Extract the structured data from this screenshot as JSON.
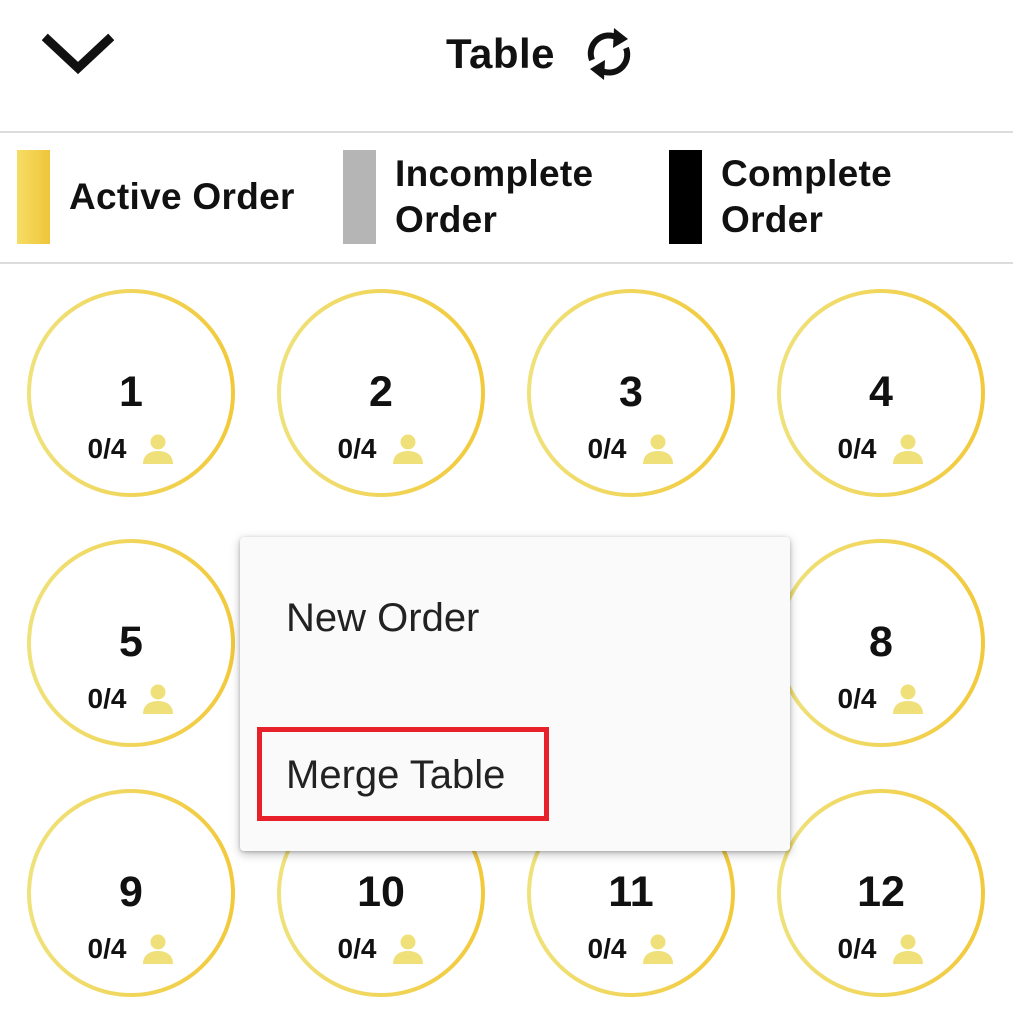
{
  "header": {
    "title": "Table",
    "back_icon": "chevron-down-icon",
    "refresh_icon": "refresh-icon"
  },
  "legend": [
    {
      "label": "Active Order",
      "color": "#f2cf4a"
    },
    {
      "label": "Incomplete\nOrder",
      "color": "#b5b5b5"
    },
    {
      "label": "Complete\nOrder",
      "color": "#000000"
    }
  ],
  "tables": [
    {
      "number": "1",
      "seats": "0/4"
    },
    {
      "number": "2",
      "seats": "0/4"
    },
    {
      "number": "3",
      "seats": "0/4"
    },
    {
      "number": "4",
      "seats": "0/4"
    },
    {
      "number": "5",
      "seats": "0/4"
    },
    {
      "number": "8",
      "seats": "0/4"
    },
    {
      "number": "9",
      "seats": "0/4"
    },
    {
      "number": "10",
      "seats": "0/4"
    },
    {
      "number": "11",
      "seats": "0/4"
    },
    {
      "number": "12",
      "seats": "0/4"
    }
  ],
  "menu": {
    "items": [
      {
        "label": "New Order"
      },
      {
        "label": "Merge Table"
      }
    ],
    "highlight_color": "#e8202a"
  },
  "colors": {
    "accent_yellow": "#f2c93a",
    "person_icon": "#efe07a"
  }
}
